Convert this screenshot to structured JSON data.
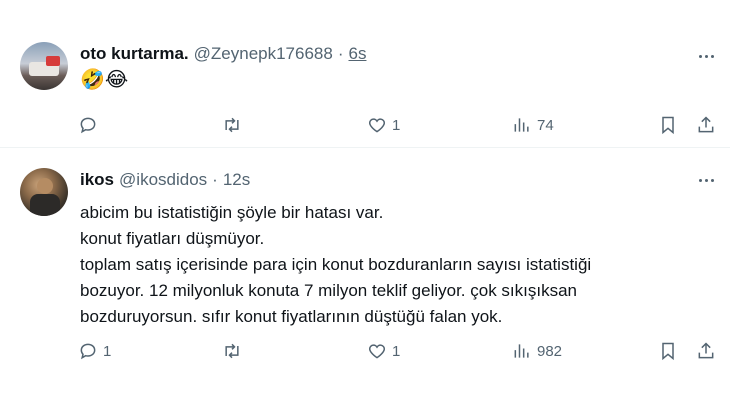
{
  "tweets": [
    {
      "name": "oto kurtarma.",
      "handle": "@Zeynepk176688",
      "separator": "·",
      "time": "6s",
      "content": [
        "🤣😂"
      ],
      "replies": "",
      "retweets": "",
      "likes": "1",
      "views": "74"
    },
    {
      "name": "ikos",
      "handle": "@ikosdidos",
      "separator": "·",
      "time": "12s",
      "content": [
        "abicim bu istatistiğin şöyle bir hatası var.",
        "konut fiyatları düşmüyor.",
        "toplam satış içerisinde para için konut bozduranların sayısı istatistiği",
        "bozuyor. 12 milyonluk konuta 7 milyon teklif geliyor. çok sıkışıksan",
        "bozduruyorsun. sıfır konut fiyatlarının düştüğü falan yok."
      ],
      "replies": "1",
      "retweets": "",
      "likes": "1",
      "views": "982"
    }
  ],
  "icons": [
    "reply-icon",
    "retweet-icon",
    "like-icon",
    "views-icon",
    "bookmark-icon",
    "share-icon",
    "more-icon"
  ]
}
